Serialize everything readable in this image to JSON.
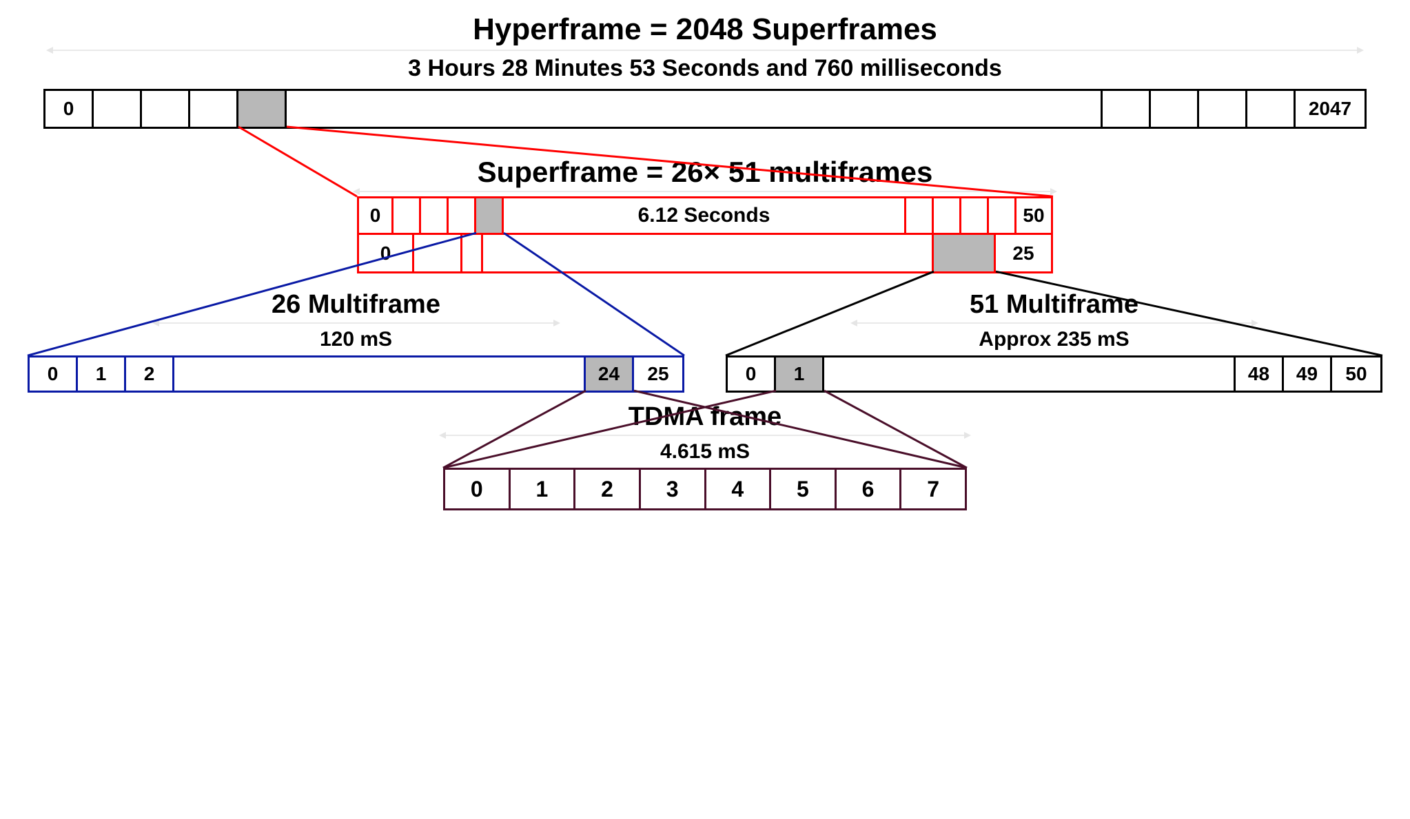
{
  "hyperframe": {
    "title": "Hyperframe = 2048 Superframes",
    "duration": "3 Hours 28 Minutes 53 Seconds and 760 milliseconds",
    "first": "0",
    "last": "2047"
  },
  "superframe": {
    "title": "Superframe = 26× 51 multiframes",
    "duration": "6.12 Seconds",
    "row1_first": "0",
    "row1_last": "50",
    "row2_first": "0",
    "row2_last": "25"
  },
  "mf26": {
    "title": "26 Multiframe",
    "duration": "120 mS",
    "cells": {
      "c0": "0",
      "c1": "1",
      "c2": "2",
      "c24": "24",
      "c25": "25"
    }
  },
  "mf51": {
    "title": "51 Multiframe",
    "duration": "Approx 235 mS",
    "cells": {
      "c0": "0",
      "c1": "1",
      "c48": "48",
      "c49": "49",
      "c50": "50"
    }
  },
  "tdma": {
    "title": "TDMA frame",
    "duration": "4.615 mS",
    "slots": {
      "s0": "0",
      "s1": "1",
      "s2": "2",
      "s3": "3",
      "s4": "4",
      "s5": "5",
      "s6": "6",
      "s7": "7"
    }
  },
  "colors": {
    "hyperframe_border": "#000000",
    "superframe_border": "#ff0000",
    "mf26_border": "#0a1aa5",
    "mf51_border": "#000000",
    "tdma_border": "#4a0f2a",
    "selected_fill": "#b8b8b8"
  }
}
